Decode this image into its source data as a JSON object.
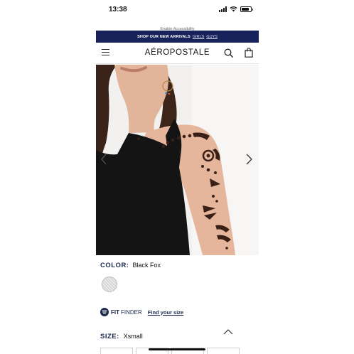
{
  "status_bar": {
    "time": "13:38"
  },
  "accessibility": {
    "link": "Enable Accessibility"
  },
  "promo": {
    "text": "SHOP OUR NEW ARRIVALS",
    "links": [
      "GIRLS",
      "GUYS"
    ]
  },
  "header": {
    "logo": "AÉROPOSTALE"
  },
  "product": {
    "color_label": "COLOR:",
    "color_value": "Black Fox",
    "fit_finder": {
      "brand_bold": "FIT",
      "brand_light": "FINDER",
      "link": "Find your size"
    },
    "size_label": "SIZE:",
    "size_value": "Xsmall"
  },
  "colors": {
    "navy": "#17235a",
    "heading": "#1b2a4e"
  },
  "icons": [
    "menu-icon",
    "search-icon",
    "bag-icon",
    "chevron-left-icon",
    "chevron-right-icon",
    "chevron-up-icon",
    "fit-finder-icon",
    "signal-icon",
    "wifi-icon",
    "battery-icon"
  ]
}
